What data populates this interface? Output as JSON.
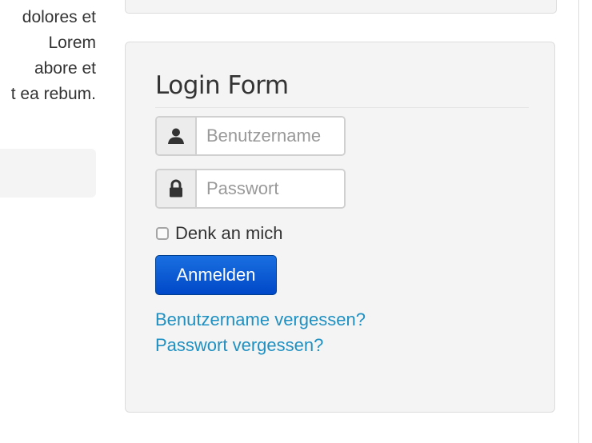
{
  "left_column": {
    "lines": [
      "dolores et",
      "Lorem",
      "abore et",
      "t ea rebum."
    ]
  },
  "login": {
    "title": "Login Form",
    "username_placeholder": "Benutzername",
    "username_icon": "user-icon",
    "password_placeholder": "Passwort",
    "password_icon": "lock-icon",
    "remember_label": "Denk an mich",
    "remember_checked": false,
    "submit_label": "Anmelden",
    "forgot_username": "Benutzername vergessen?",
    "forgot_password": "Passwort vergessen?"
  },
  "colors": {
    "panel_bg": "#f4f4f4",
    "button_blue": "#0a5fd8",
    "link_blue": "#1f90c2"
  }
}
